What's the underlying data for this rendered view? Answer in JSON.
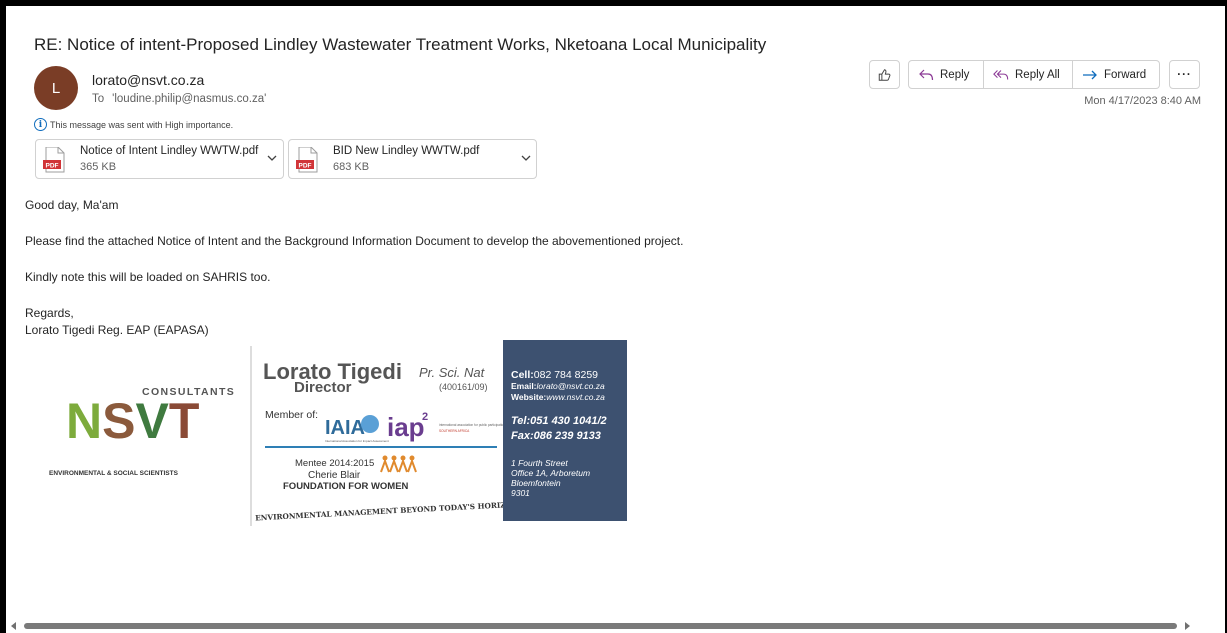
{
  "email": {
    "subject": "RE: Notice of intent-Proposed Lindley Wastewater Treatment Works, Nketoana Local Municipality",
    "avatar_initial": "L",
    "sender": "lorato@nsvt.co.za",
    "to_label": "To",
    "to_value": "'loudine.philip@nasmus.co.za'",
    "importance": "This message was sent with High importance.",
    "date": "Mon 4/17/2023 8:40 AM"
  },
  "toolbar": {
    "reply": "Reply",
    "reply_all": "Reply All",
    "forward": "Forward"
  },
  "attachments": [
    {
      "name": "Notice of Intent Lindley WWTW.pdf",
      "size": "365 KB",
      "icon": "pdf-icon"
    },
    {
      "name": "BID New Lindley WWTW.pdf",
      "size": "683 KB",
      "icon": "pdf-icon"
    }
  ],
  "pdf_label": "PDF",
  "body": {
    "greeting": "Good day, Ma'am",
    "p1": "Please find the attached Notice of Intent and the Background Information Document to develop the abovementioned project.",
    "p2": "Kindly note this will be loaded on SAHRIS too.",
    "closing": "Regards,",
    "signoff": "Lorato Tigedi Reg. EAP (EAPASA)"
  },
  "signature": {
    "logo_consultants": "CONSULTANTS",
    "logo_letters": "NSVT",
    "logo_tagline": "ENVIRONMENTAL & SOCIAL SCIENTISTS",
    "name": "Lorato Tigedi",
    "designation": "Pr. Sci. Nat",
    "role": "Director",
    "reg_no": "(400161/09)",
    "member_of": "Member of:",
    "iaia": "IAIA",
    "iaia_sub": "International Association for Impact Assessment",
    "iap": "iap",
    "iap_sup": "2",
    "iap_sub": "international association for public participation",
    "iap_region": "SOUTHERN AFRICA",
    "mentee": "Mentee 2014:2015",
    "cherie": "Cherie Blair",
    "foundation": "FOUNDATION FOR WOMEN",
    "motto": "ENVIRONMENTAL MANAGEMENT BEYOND TODAY'S HORIZON",
    "cell_label": "Cell:",
    "cell": "082 784 8259",
    "email_label": "Email:",
    "email": "lorato@nsvt.co.za",
    "website_label": "Website:",
    "website": "www.nsvt.co.za",
    "tel_label": "Tel:",
    "tel": "051 430 1041/2",
    "fax_label": "Fax:",
    "fax": "086 239 9133",
    "addr1": "1 Fourth Street",
    "addr2": "Office 1A, Arboretum",
    "addr3": "Bloemfontein",
    "addr4": "9301"
  },
  "colors": {
    "accent": "#0f6cbd",
    "avatar": "#7a3d26",
    "pdf_red": "#d13438",
    "sig_panel": "#3d5170"
  }
}
